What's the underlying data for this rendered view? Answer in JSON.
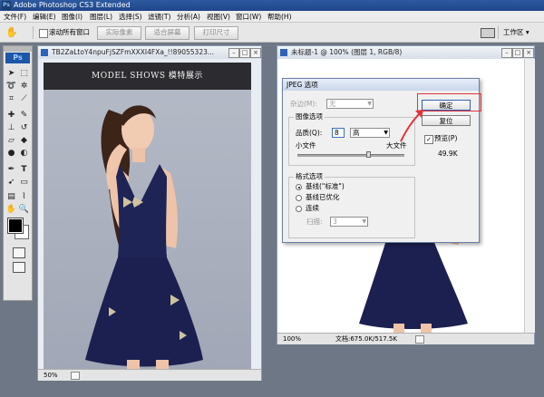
{
  "titlebar": {
    "app_icon": "Ps",
    "title": "Adobe Photoshop CS3 Extended"
  },
  "menubar": {
    "items": [
      "文件(F)",
      "编辑(E)",
      "图像(I)",
      "图层(L)",
      "选择(S)",
      "滤镜(T)",
      "分析(A)",
      "视图(V)",
      "窗口(W)",
      "帮助(H)"
    ]
  },
  "options_bar": {
    "scroll_all_label": "滚动所有窗口",
    "btn_actual": "实际像素",
    "btn_fit": "适合屏幕",
    "btn_print": "打印尺寸",
    "workspace_label": "工作区 ▾"
  },
  "toolbox": {
    "tag": "Ps",
    "fg_color": "#000000",
    "bg_color": "#ffffff"
  },
  "doc_left": {
    "title": "TB2ZaLtoY4npuFjSZFmXXXI4FXa_!!89055323...",
    "header_text": "MODEL SHOWS 模特展示",
    "zoom": "50%"
  },
  "doc_right": {
    "title": "未标题-1 @ 100% (图层 1, RGB/8)",
    "zoom": "100%",
    "doc_size": "文档:675.0K/517.5K"
  },
  "jpeg_dialog": {
    "title": "JPEG 选项",
    "matte_label": "杂边(M):",
    "matte_value": "无",
    "image_options_group": "图像选项",
    "quality_label": "品质(Q):",
    "quality_value": "8",
    "quality_level": "高",
    "small_file": "小文件",
    "large_file": "大文件",
    "quality_fraction": 0.667,
    "format_group": "格式选项",
    "format_baseline_std": "基线(\"标准\")",
    "format_baseline_opt": "基线已优化",
    "format_progressive": "连续",
    "scans_label": "扫描:",
    "scans_value": "3",
    "ok": "确定",
    "reset": "复位",
    "preview_label": "预览(P)",
    "file_size": "49.9K",
    "highlight_color": "#e0333a"
  }
}
